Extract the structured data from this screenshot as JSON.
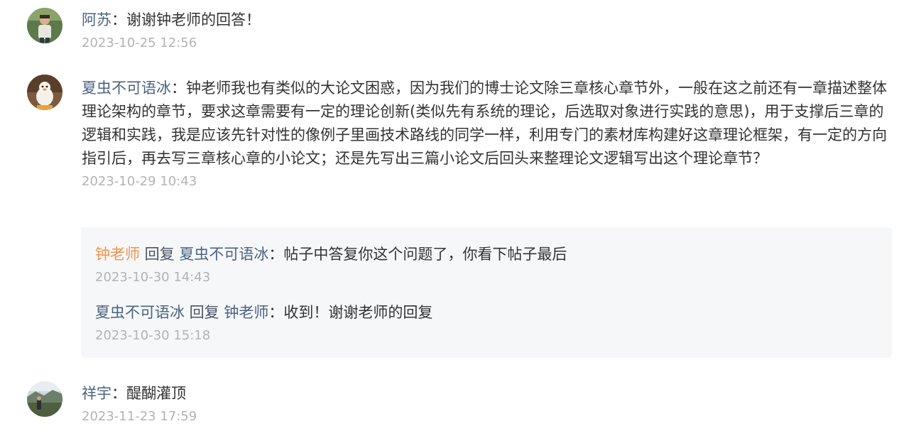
{
  "comments": [
    {
      "author": "阿苏",
      "separator": "：",
      "text": "谢谢钟老师的回答！",
      "time": "2023-10-25 12:56",
      "avatar_icon": "person-photo-icon"
    },
    {
      "author": "夏虫不可语冰",
      "separator": "：",
      "text": "钟老师我也有类似的大论文困惑，因为我们的博士论文除三章核心章节外，一般在这之前还有一章描述整体理论架构的章节，要求这章需要有一定的理论创新(类似先有系统的理论，后选取对象进行实践的意思)，用于支撑后三章的逻辑和实践，我是应该先针对性的像例子里画技术路线的同学一样，利用专门的素材库构建好这章理论框架，有一定的方向指引后，再去写三章核心章的小论文；还是先写出三篇小论文后回头来整理论文逻辑写出这个理论章节？",
      "time": "2023-10-29 10:43",
      "avatar_icon": "duck-avatar-icon"
    },
    {
      "author": "祥宇",
      "separator": "：",
      "text": "醍醐灌顶",
      "time": "2023-11-23 17:59",
      "avatar_icon": "landscape-photo-icon"
    }
  ],
  "replies": [
    {
      "from": "钟老师",
      "reply_word": " 回复 ",
      "to": "夏虫不可语冰",
      "separator": "：",
      "text": "帖子中答复你这个问题了，你看下帖子最后",
      "time": "2023-10-30 14:43"
    },
    {
      "from": "夏虫不可语冰",
      "reply_word": " 回复 ",
      "to": "钟老师",
      "separator": "：",
      "text": "收到！谢谢老师的回复",
      "time": "2023-10-30 15:18"
    }
  ],
  "colors": {
    "name": "#4a6380",
    "teacher_name": "#f0954c",
    "time": "#b3b3b3",
    "reply_bg": "#f6f7f9"
  }
}
